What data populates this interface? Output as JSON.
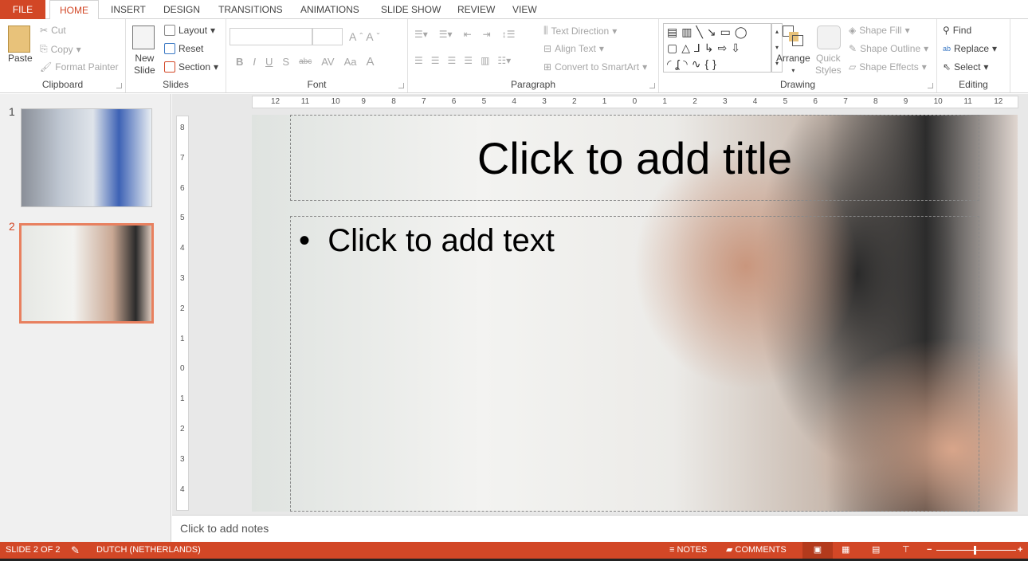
{
  "tabs": [
    "FILE",
    "HOME",
    "INSERT",
    "DESIGN",
    "TRANSITIONS",
    "ANIMATIONS",
    "SLIDE SHOW",
    "REVIEW",
    "VIEW"
  ],
  "ribbon": {
    "clipboard": {
      "label": "Clipboard",
      "paste": "Paste",
      "cut": "Cut",
      "copy": "Copy",
      "format_painter": "Format Painter"
    },
    "slides": {
      "label": "Slides",
      "new_slide_1": "New",
      "new_slide_2": "Slide",
      "layout": "Layout",
      "reset": "Reset",
      "section": "Section"
    },
    "font": {
      "label": "Font",
      "font_name": "",
      "font_size": "",
      "bold": "B",
      "italic": "I",
      "underline": "U",
      "shadow": "S",
      "strike": "abc",
      "spacing": "AV",
      "case": "Aa",
      "color": "A"
    },
    "paragraph": {
      "label": "Paragraph",
      "text_direction": "Text Direction",
      "align_text": "Align Text",
      "smartart": "Convert to SmartArt"
    },
    "drawing": {
      "label": "Drawing",
      "arrange": "Arrange",
      "quick_1": "Quick",
      "quick_2": "Styles",
      "shape_fill": "Shape Fill",
      "shape_outline": "Shape Outline",
      "shape_effects": "Shape Effects"
    },
    "editing": {
      "label": "Editing",
      "find": "Find",
      "replace": "Replace",
      "select": "Select"
    }
  },
  "slides_panel": [
    {
      "num": "1"
    },
    {
      "num": "2",
      "selected": true
    }
  ],
  "ruler": {
    "h": [
      "12",
      "11",
      "10",
      "9",
      "8",
      "7",
      "6",
      "5",
      "4",
      "3",
      "2",
      "1",
      "0",
      "1",
      "2",
      "3",
      "4",
      "5",
      "6",
      "7",
      "8",
      "9",
      "10",
      "11",
      "12"
    ],
    "v": [
      "8",
      "7",
      "6",
      "5",
      "4",
      "3",
      "2",
      "1",
      "0",
      "1",
      "2",
      "3",
      "4"
    ]
  },
  "slide": {
    "title": "Click to add title",
    "body": "Click to add text"
  },
  "notes": "Click to add notes",
  "status": {
    "slide": "SLIDE 2 OF 2",
    "language": "DUTCH (NETHERLANDS)",
    "notes": "NOTES",
    "comments": "COMMENTS"
  },
  "colors": {
    "accent": "#d24726"
  }
}
